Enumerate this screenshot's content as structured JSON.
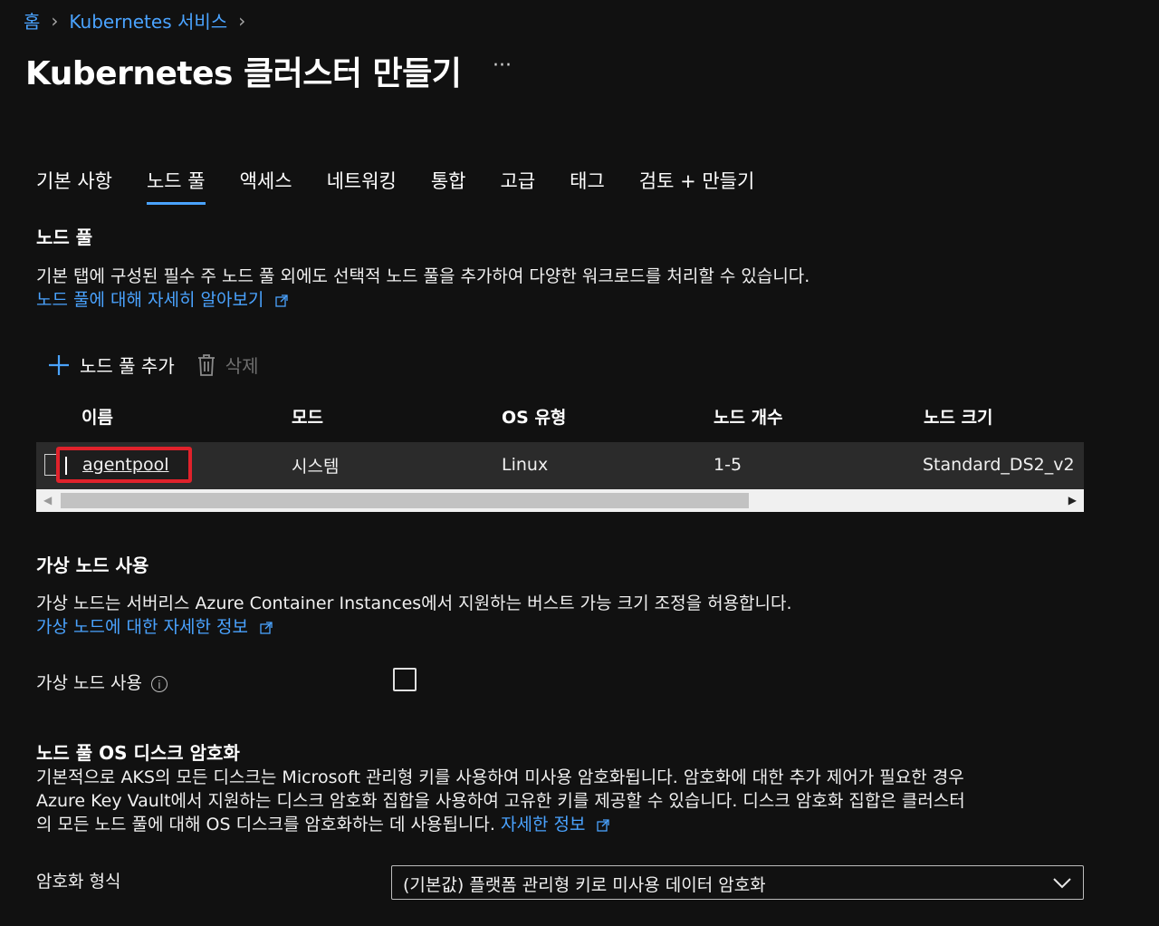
{
  "breadcrumb": {
    "home": "홈",
    "service": "Kubernetes 서비스"
  },
  "page": {
    "title": "Kubernetes 클러스터 만들기",
    "more": "···"
  },
  "tabs": [
    {
      "label": "기본 사항"
    },
    {
      "label": "노드 풀",
      "active": true
    },
    {
      "label": "액세스"
    },
    {
      "label": "네트워킹"
    },
    {
      "label": "통합"
    },
    {
      "label": "고급"
    },
    {
      "label": "태그"
    },
    {
      "label": "검토 + 만들기"
    }
  ],
  "nodepool": {
    "heading": "노드 풀",
    "description": "기본 탭에 구성된 필수 주 노드 풀 외에도 선택적 노드 풀을 추가하여 다양한 워크로드를 처리할 수 있습니다.",
    "learn_more": "노드 풀에 대해 자세히 알아보기",
    "toolbar": {
      "add": "노드 풀 추가",
      "delete": "삭제"
    },
    "columns": [
      "이름",
      "모드",
      "OS 유형",
      "노드 개수",
      "노드 크기"
    ],
    "rows": [
      {
        "name": "agentpool",
        "mode": "시스템",
        "os": "Linux",
        "count": "1-5",
        "size": "Standard_DS2_v2"
      }
    ]
  },
  "virtual_nodes": {
    "heading": "가상 노드 사용",
    "description": "가상 노드는 서버리스 Azure Container Instances에서 지원하는 버스트 가능 크기 조정을 허용합니다.",
    "link": "가상 노드에 대한 자세한 정보",
    "field_label": "가상 노드 사용",
    "checked": false
  },
  "encryption": {
    "heading": "노드 풀 OS 디스크 암호화",
    "line1": "기본적으로 AKS의 모든 디스크는 Microsoft 관리형 키를 사용하여 미사용 암호화됩니다. 암호화에 대한 추가 제어가 필요한 경우",
    "line2": "Azure Key Vault에서 지원하는 디스크 암호화 집합을 사용하여 고유한 키를 제공할 수 있습니다. 디스크 암호화 집합은 클러스터",
    "line3": "의 모든 노드 풀에 대해 OS 디스크를 암호화하는 데 사용됩니다.",
    "link": "자세한 정보",
    "field_label": "암호화 형식",
    "selected": "(기본값) 플랫폼 관리형 키로 미사용 데이터 암호화"
  },
  "colors": {
    "accent": "#4aa3ff",
    "highlight": "#e0222b",
    "background": "#111111"
  }
}
